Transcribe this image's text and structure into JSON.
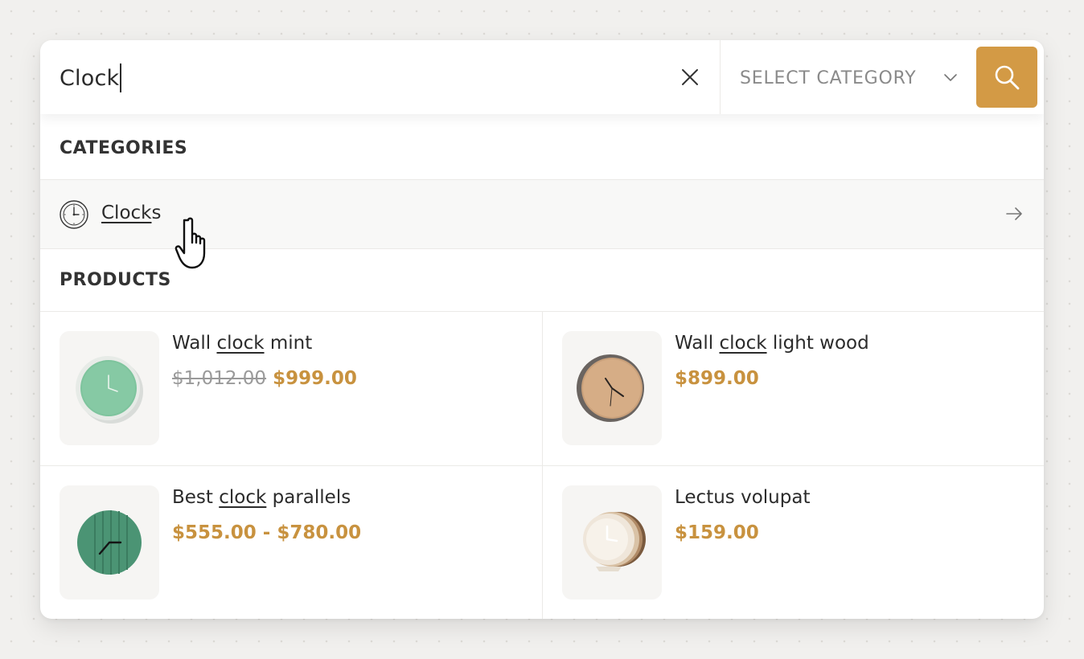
{
  "search": {
    "query": "Clock",
    "category_placeholder": "SELECT CATEGORY"
  },
  "sections": {
    "categories_title": "CATEGORIES",
    "products_title": "PRODUCTS"
  },
  "categories": [
    {
      "match": "Clock",
      "rest": "s",
      "icon": "clock-icon"
    }
  ],
  "products": [
    {
      "pre": "Wall ",
      "match": "clock",
      "post": " mint",
      "old_price": "$1,012.00",
      "price": "$999.00"
    },
    {
      "pre": "Wall ",
      "match": "clock",
      "post": " light wood",
      "old_price": "",
      "price": "$899.00"
    },
    {
      "pre": "Best ",
      "match": "clock",
      "post": " parallels",
      "old_price": "",
      "price": "$555.00 - $780.00"
    },
    {
      "pre": "Lectus volupat",
      "match": "",
      "post": "",
      "old_price": "",
      "price": "$159.00"
    }
  ],
  "colors": {
    "accent": "#d39a45",
    "price": "#c8923f",
    "background": "#f1f0ee"
  }
}
